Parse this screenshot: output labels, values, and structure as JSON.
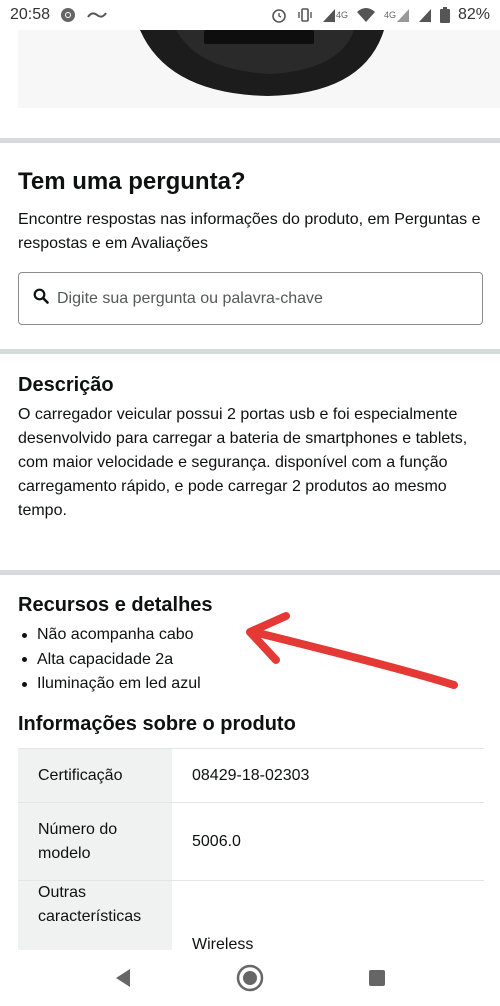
{
  "status_bar": {
    "time": "20:58",
    "network_label_1": "4G",
    "network_label_2": "4G",
    "battery": "82%"
  },
  "question": {
    "title": "Tem uma pergunta?",
    "subtitle": "Encontre respostas nas informações do produto, em Perguntas e respostas e em Avaliações",
    "search_placeholder": "Digite sua pergunta ou palavra-chave"
  },
  "description": {
    "title": "Descrição",
    "text": "O carregador veicular possui 2 portas usb e foi especialmente desenvolvido para carregar a bateria de smartphones e tablets, com maior velocidade e segurança. disponível com a função carregamento rápido, e pode carregar 2 produtos ao mesmo tempo."
  },
  "features": {
    "title": "Recursos e detalhes",
    "items": [
      "Não acompanha cabo",
      "Alta capacidade 2a",
      "Iluminação em led azul"
    ]
  },
  "product_info": {
    "title": "Informações sobre o produto",
    "rows": [
      {
        "key": "Certificação",
        "value": "08429-18-02303"
      },
      {
        "key": "Número do modelo",
        "value": "5006.0"
      },
      {
        "key": "Outras características",
        "value": "Wireless"
      }
    ]
  },
  "colors": {
    "arrow": "#e53935",
    "divider": "#d5dbdb",
    "table_key_bg": "#f0f2f2"
  },
  "icons": {
    "search": "search-icon",
    "back": "back-triangle-icon",
    "home": "home-circle-icon",
    "recents": "recents-square-icon"
  }
}
